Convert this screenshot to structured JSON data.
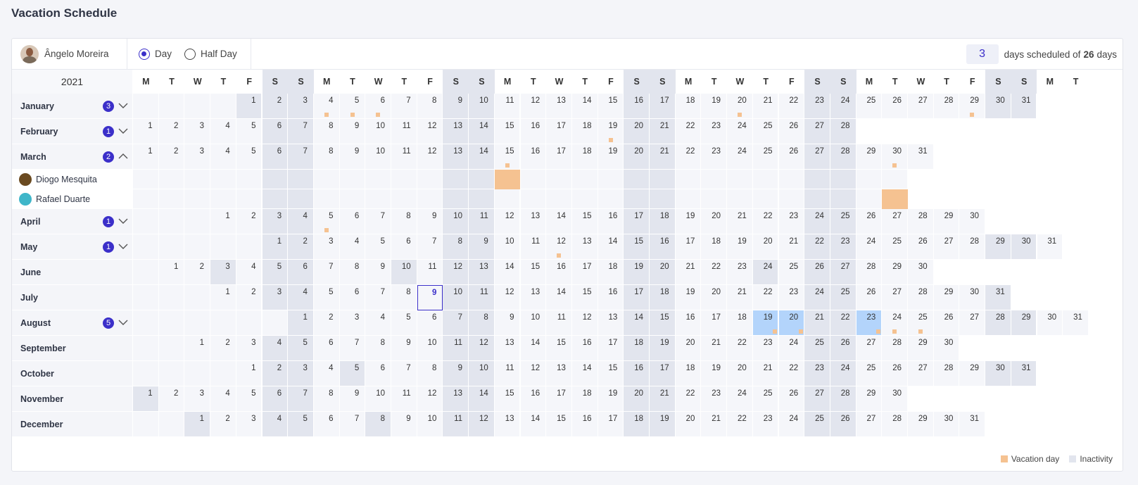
{
  "page": {
    "title": "Vacation Schedule"
  },
  "toolbar": {
    "user_name": "Ângelo Moreira",
    "mode_options": [
      {
        "label": "Day",
        "checked": true
      },
      {
        "label": "Half Day",
        "checked": false
      }
    ],
    "scheduled_count": "3",
    "summary_prefix": "days scheduled of",
    "total_days": "26",
    "summary_suffix": "days"
  },
  "calendar": {
    "year": "2021",
    "weekday_headers": [
      "M",
      "T",
      "W",
      "T",
      "F",
      "S",
      "S",
      "M",
      "T",
      "W",
      "T",
      "F",
      "S",
      "S",
      "M",
      "T",
      "W",
      "T",
      "F",
      "S",
      "S",
      "M",
      "T",
      "W",
      "T",
      "F",
      "S",
      "S",
      "M",
      "T",
      "W",
      "T",
      "F",
      "S",
      "S",
      "M",
      "T"
    ],
    "today": {
      "month": 7,
      "day": 9
    },
    "months": [
      {
        "name": "January",
        "badge": "3",
        "expanded": false,
        "vacation_dots": [
          4,
          5,
          6,
          20,
          29
        ]
      },
      {
        "name": "February",
        "badge": "1",
        "expanded": false,
        "vacation_dots": [
          19
        ]
      },
      {
        "name": "March",
        "badge": "2",
        "expanded": true,
        "vacation_dots": [
          15,
          30
        ],
        "members": [
          {
            "name": "Diogo Mesquita",
            "vacation_days": [
              15
            ],
            "icon_color": "#6a4a20"
          },
          {
            "name": "Rafael Duarte",
            "vacation_days": [
              30
            ],
            "icon_color": "#3fb6c9"
          }
        ]
      },
      {
        "name": "April",
        "badge": "1",
        "expanded": false,
        "vacation_dots": [
          5
        ]
      },
      {
        "name": "May",
        "badge": "1",
        "expanded": false,
        "vacation_dots": [
          12
        ]
      },
      {
        "name": "June",
        "badge": "",
        "expanded": false,
        "vacation_dots": []
      },
      {
        "name": "July",
        "badge": "",
        "expanded": false,
        "vacation_dots": []
      },
      {
        "name": "August",
        "badge": "5",
        "expanded": false,
        "vacation_dots": [
          19,
          20,
          23,
          24,
          25
        ],
        "highlighted": [
          19,
          20,
          23
        ]
      },
      {
        "name": "September",
        "badge": "",
        "expanded": false,
        "vacation_dots": []
      },
      {
        "name": "October",
        "badge": "",
        "expanded": false,
        "vacation_dots": []
      },
      {
        "name": "November",
        "badge": "",
        "expanded": false,
        "vacation_dots": []
      },
      {
        "name": "December",
        "badge": "",
        "expanded": false,
        "vacation_dots": []
      }
    ],
    "inactive_weekdays": {
      "1": [
        1
      ],
      "6": [
        3,
        10,
        24
      ],
      "8": [
        1
      ],
      "10": [
        5
      ],
      "11": [
        1
      ],
      "12": [
        1,
        8
      ]
    }
  },
  "legend": {
    "vacation_label": "Vacation day",
    "inactivity_label": "Inactivity"
  },
  "colors": {
    "accent": "#3b2fc9",
    "vacation": "#f5c291",
    "inactivity": "#e2e5ee",
    "highlight": "#b3d4fb"
  }
}
